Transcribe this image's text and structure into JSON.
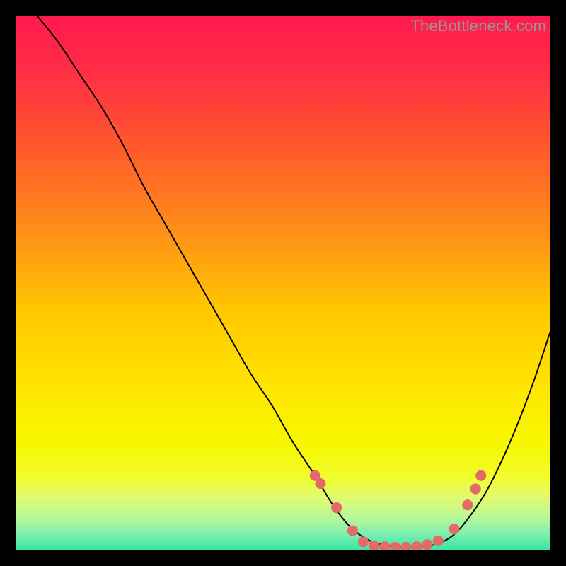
{
  "watermark": "TheBottleneck.com",
  "chart_data": {
    "type": "line",
    "title": "",
    "xlabel": "",
    "ylabel": "",
    "xlim": [
      0,
      100
    ],
    "ylim": [
      0,
      100
    ],
    "grid": false,
    "legend": false,
    "gradient_stops": [
      {
        "offset": 0.0,
        "color": "#ff1a4e"
      },
      {
        "offset": 0.1,
        "color": "#ff2c45"
      },
      {
        "offset": 0.25,
        "color": "#ff5a2b"
      },
      {
        "offset": 0.4,
        "color": "#ff8e18"
      },
      {
        "offset": 0.55,
        "color": "#ffc700"
      },
      {
        "offset": 0.7,
        "color": "#ffe600"
      },
      {
        "offset": 0.8,
        "color": "#f7f700"
      },
      {
        "offset": 0.86,
        "color": "#f2fc2a"
      },
      {
        "offset": 0.9,
        "color": "#e1fb6d"
      },
      {
        "offset": 0.94,
        "color": "#b6f79a"
      },
      {
        "offset": 0.97,
        "color": "#7aeeb0"
      },
      {
        "offset": 1.0,
        "color": "#36e6a4"
      }
    ],
    "series": [
      {
        "name": "bottleneck-curve",
        "x": [
          4,
          8,
          12,
          16,
          20,
          24,
          28,
          32,
          36,
          40,
          44,
          48,
          52,
          56,
          59,
          62,
          65,
          68,
          71,
          73,
          76,
          79,
          82,
          85,
          88,
          91,
          94,
          97,
          100
        ],
        "y": [
          100,
          95,
          89,
          83,
          76,
          68,
          61,
          54,
          47,
          40,
          33,
          27,
          20,
          14,
          9,
          5,
          2.5,
          1.2,
          0.7,
          0.6,
          0.7,
          1.3,
          3,
          6.5,
          11,
          17,
          24,
          32,
          41
        ]
      }
    ],
    "markers": {
      "name": "highlight-dots",
      "color": "#e46a6a",
      "radius": 1.0,
      "points": [
        {
          "x": 56,
          "y": 14
        },
        {
          "x": 57,
          "y": 12.5
        },
        {
          "x": 60,
          "y": 8
        },
        {
          "x": 63,
          "y": 3.7
        },
        {
          "x": 65,
          "y": 1.6
        },
        {
          "x": 67,
          "y": 0.9
        },
        {
          "x": 69,
          "y": 0.7
        },
        {
          "x": 71,
          "y": 0.6
        },
        {
          "x": 73,
          "y": 0.6
        },
        {
          "x": 75,
          "y": 0.7
        },
        {
          "x": 77,
          "y": 1.1
        },
        {
          "x": 79,
          "y": 1.8
        },
        {
          "x": 82,
          "y": 4.0
        },
        {
          "x": 84.5,
          "y": 8.5
        },
        {
          "x": 86,
          "y": 11.5
        },
        {
          "x": 87,
          "y": 14
        }
      ]
    }
  }
}
